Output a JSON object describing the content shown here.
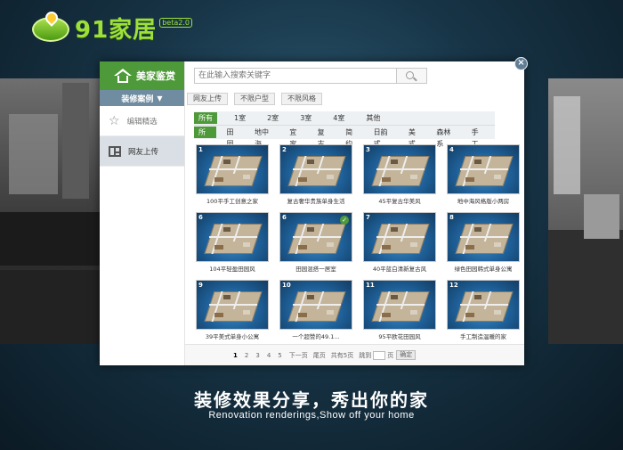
{
  "logo": {
    "text": "91家居",
    "version": "beta2.0"
  },
  "sidebar": {
    "header": "美家鉴赏",
    "sub": "装修案例",
    "items": [
      {
        "label": "编辑精选",
        "icon": "star-icon",
        "active": false
      },
      {
        "label": "网友上传",
        "icon": "layout-icon",
        "active": true
      }
    ]
  },
  "search": {
    "placeholder": "在此输入搜索关键字",
    "value": ""
  },
  "filters": [
    "网友上传",
    "不限户型",
    "不限风格"
  ],
  "categories": {
    "rooms": [
      "所有",
      "1室",
      "2室",
      "3室",
      "4室",
      "其他"
    ],
    "styles": [
      "所有",
      "田园",
      "地中海",
      "宜家",
      "复古",
      "简约",
      "日韵式",
      "美式",
      "森林系",
      "手工"
    ]
  },
  "cards": [
    {
      "num": "1",
      "caption": "100平手工创意之家"
    },
    {
      "num": "2",
      "caption": "复古奢华贵族单身生活"
    },
    {
      "num": "3",
      "caption": "45平复古华美风"
    },
    {
      "num": "4",
      "caption": "地中海风格版小两房"
    },
    {
      "num": "6",
      "caption": "104平轻盈田园风"
    },
    {
      "num": "6",
      "caption": "田园混搭一居室"
    },
    {
      "num": "7",
      "caption": "40平蓝白清新复古风"
    },
    {
      "num": "8",
      "caption": "绿色田园韩式单身公寓"
    },
    {
      "num": "9",
      "caption": "39平美式单身小公寓"
    },
    {
      "num": "10",
      "caption": "一个超赞的49.1..."
    },
    {
      "num": "11",
      "caption": "95平欧花田园风"
    },
    {
      "num": "12",
      "caption": "手工制造温暖的家"
    }
  ],
  "pager": {
    "pages": [
      "1",
      "2",
      "3",
      "4",
      "5"
    ],
    "next": "下一页",
    "last": "尾页",
    "total": "共有5页",
    "jump_label": "跳到",
    "page_unit": "页",
    "confirm": "确定"
  },
  "slogan": {
    "cn": "装修效果分享，秀出你的家",
    "en": "Renovation renderings,Show off your home"
  },
  "colors": {
    "accent": "#4e9a3a",
    "sub_bar": "#6f8ca0",
    "background": "#173446"
  }
}
